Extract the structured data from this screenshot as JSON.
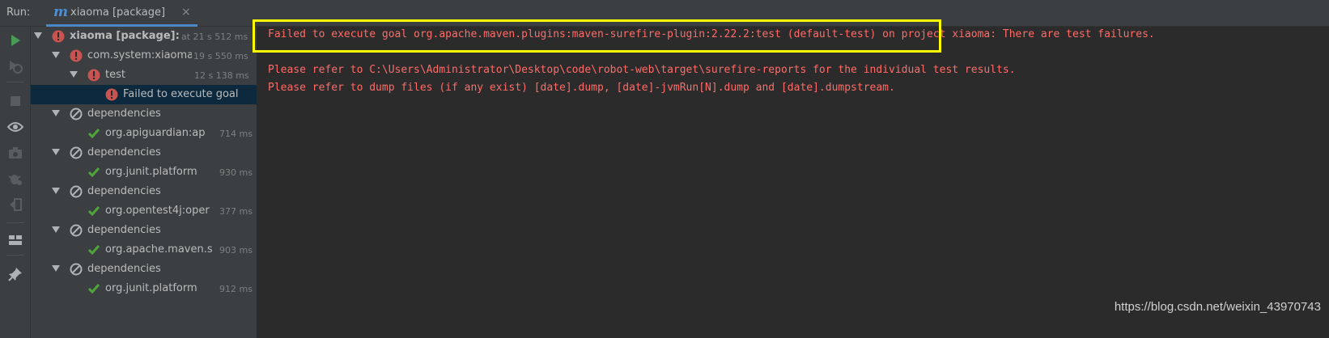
{
  "run_label": "Run:",
  "tab": {
    "icon": "m",
    "title": "xiaoma [package]",
    "close": "×"
  },
  "toolbar_icons": [
    "play-icon",
    "rerun-failed-icon",
    "stop-icon",
    "eye-icon",
    "camera-icon",
    "bug-settings-icon",
    "exit-icon",
    "layout-icon",
    "pin-icon"
  ],
  "tree": [
    {
      "label": "xiaoma [package]:",
      "time": "at 21 s 512 ms",
      "status": "error",
      "bold": true
    },
    {
      "label": "com.system:xiaoma",
      "time": "19 s 550 ms",
      "status": "error"
    },
    {
      "label": "test",
      "time": "12 s 138 ms",
      "status": "error"
    },
    {
      "label": "Failed to execute goal",
      "time": "",
      "status": "error"
    },
    {
      "label": "dependencies",
      "time": "",
      "status": "skipped"
    },
    {
      "label": "org.apiguardian:ap",
      "time": "714 ms",
      "status": "ok"
    },
    {
      "label": "dependencies",
      "time": "",
      "status": "skipped"
    },
    {
      "label": "org.junit.platform",
      "time": "930 ms",
      "status": "ok"
    },
    {
      "label": "dependencies",
      "time": "",
      "status": "skipped"
    },
    {
      "label": "org.opentest4j:oper",
      "time": "377 ms",
      "status": "ok"
    },
    {
      "label": "dependencies",
      "time": "",
      "status": "skipped"
    },
    {
      "label": "org.apache.maven.s",
      "time": "903 ms",
      "status": "ok"
    },
    {
      "label": "dependencies",
      "time": "",
      "status": "skipped"
    },
    {
      "label": "org.junit.platform",
      "time": "912 ms",
      "status": "ok"
    }
  ],
  "console": {
    "lines": [
      "Failed to execute goal org.apache.maven.plugins:maven-surefire-plugin:2.22.2:test (default-test) on project xiaoma: There are test failures.",
      "",
      "Please refer to C:\\Users\\Administrator\\Desktop\\code\\robot-web\\target\\surefire-reports for the individual test results.",
      "Please refer to dump files (if any exist) [date].dump, [date]-jvmRun[N].dump and [date].dumpstream."
    ]
  },
  "watermark": "https://blog.csdn.net/weixin_43970743",
  "colors": {
    "error_text": "#ff6b68",
    "highlight": "#ffff00",
    "ok": "#4fa73b",
    "error_icon": "#c75450",
    "accent": "#4a88c7"
  }
}
